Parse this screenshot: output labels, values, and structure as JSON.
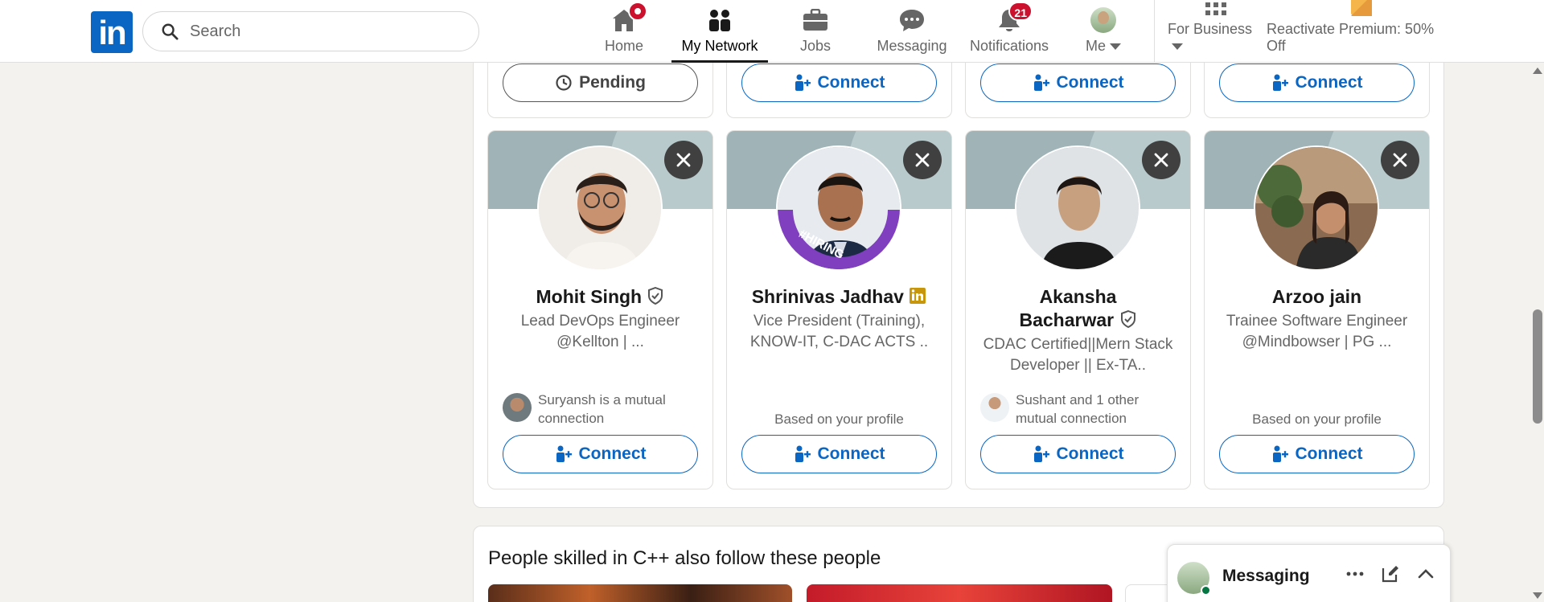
{
  "nav": {
    "logo_text": "in",
    "search_placeholder": "Search",
    "items": [
      {
        "label": "Home",
        "icon": "home-icon",
        "badge": ""
      },
      {
        "label": "My Network",
        "icon": "my-network-icon",
        "badge": ""
      },
      {
        "label": "Jobs",
        "icon": "jobs-icon",
        "badge": ""
      },
      {
        "label": "Messaging",
        "icon": "messaging-icon",
        "badge": ""
      },
      {
        "label": "Notifications",
        "icon": "notifications-icon",
        "badge": "21"
      },
      {
        "label": "Me",
        "icon": "avatar",
        "badge": ""
      }
    ],
    "for_business": "For Business",
    "premium": "Reactivate Premium: 50% Off",
    "active": "My Network"
  },
  "top_row": {
    "buttons": [
      "Pending",
      "Connect",
      "Connect",
      "Connect"
    ]
  },
  "cards": [
    {
      "name": "Mohit Singh",
      "name_badge": "verified-shield-icon",
      "headline": "Lead DevOps Engineer @Kellton | ...",
      "footer_type": "mutual",
      "footer_text": "Suryansh is a mutual connection",
      "button": "Connect"
    },
    {
      "name": "Shrinivas Jadhav",
      "name_badge": "linkedin-premium-icon",
      "headline": "Vice President (Training), KNOW-IT, C-DAC ACTS ..",
      "hiring_frame": "#HIRING",
      "footer_type": "based",
      "footer_text": "Based on your profile",
      "button": "Connect"
    },
    {
      "name": "Akansha Bacharwar",
      "name_badge": "verified-shield-icon",
      "headline": "CDAC Certified||Mern Stack Developer || Ex-TA..",
      "footer_type": "mutual",
      "footer_text": "Sushant and 1 other mutual connection",
      "button": "Connect"
    },
    {
      "name": "Arzoo jain",
      "name_badge": "",
      "headline": "Trainee Software Engineer @Mindbowser | PG ...",
      "footer_type": "based",
      "footer_text": "Based on your profile",
      "button": "Connect"
    }
  ],
  "section2": {
    "title": "People skilled in C++ also follow these people"
  },
  "messaging": {
    "label": "Messaging"
  },
  "colors": {
    "brand": "#0a66c2",
    "notification_badge": "#cb112d",
    "page_bg": "#f4f2ee",
    "online": "#057642"
  }
}
